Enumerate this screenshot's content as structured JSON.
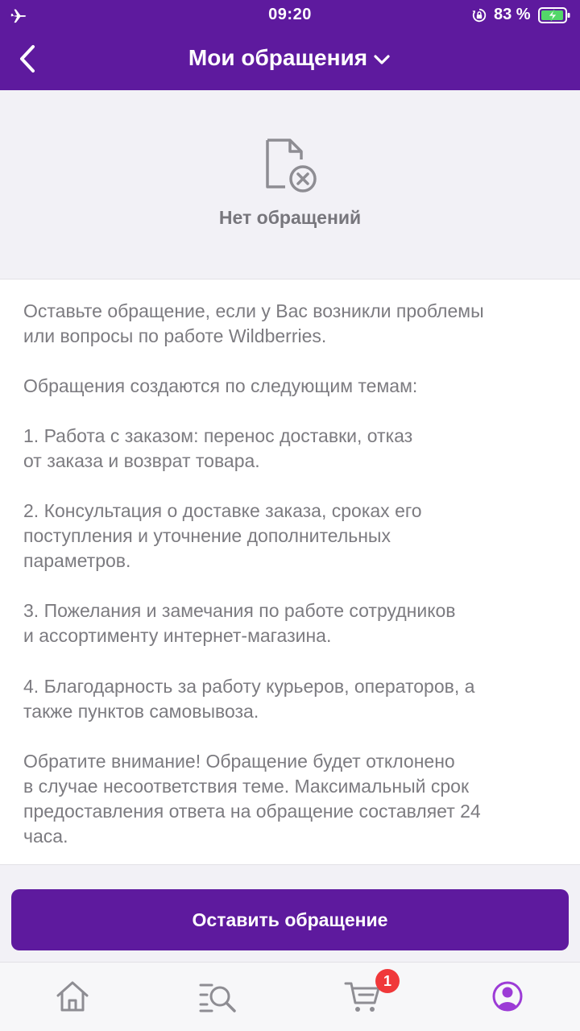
{
  "status_bar": {
    "time": "09:20",
    "battery_percent": "83 %",
    "icons": [
      "airplane-icon",
      "orientation-lock-icon",
      "battery-charging-icon"
    ]
  },
  "header": {
    "title": "Мои обращения",
    "back_icon": "chevron-left-icon",
    "dropdown_icon": "chevron-down-icon"
  },
  "empty_state": {
    "icon": "document-x-icon",
    "text": "Нет обращений"
  },
  "info": {
    "paragraphs": [
      "Оставьте обращение, если у Вас возникли проблемы\nили вопросы по работе Wildberries.",
      "Обращения создаются по следующим темам:",
      "1. Работа с заказом: перенос доставки, отказ\nот заказа и возврат товара.",
      "2. Консультация о доставке заказа, сроках его\nпоступления и уточнение дополнительных\nпараметров.",
      "3. Пожелания и замечания по работе сотрудников\nи ассортименту интернет-магазина.",
      "4. Благодарность за работу курьеров, операторов, а\nтакже пунктов самовывоза.",
      "Обратите внимание! Обращение будет отклонено\nв случае несоответствия теме. Максимальный срок\nпредоставления ответа на обращение составляет 24\nчаса."
    ]
  },
  "cta": {
    "label": "Оставить обращение"
  },
  "tabbar": {
    "items": [
      {
        "icon": "home-icon",
        "active": false
      },
      {
        "icon": "catalog-search-icon",
        "active": false
      },
      {
        "icon": "cart-icon",
        "active": false,
        "badge": "1"
      },
      {
        "icon": "profile-icon",
        "active": true
      }
    ]
  },
  "colors": {
    "brand": "#5e1a9e",
    "badge": "#f0383a",
    "icon_inactive": "#8e8d93",
    "icon_active": "#9c3bd6"
  }
}
